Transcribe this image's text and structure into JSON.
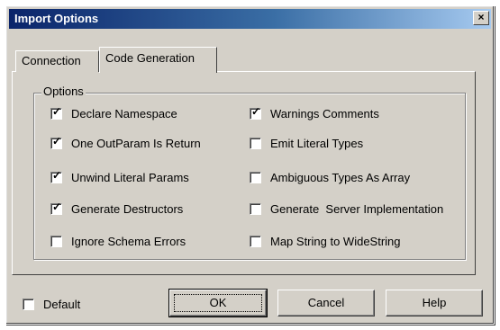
{
  "window": {
    "title": "Import Options",
    "close_glyph": "×"
  },
  "tabs": [
    {
      "label": "Connection",
      "selected": false
    },
    {
      "label": "Code Generation",
      "selected": true
    }
  ],
  "options": {
    "group_label": "Options",
    "left": [
      {
        "label": "Declare Namespace",
        "checked": true
      },
      {
        "label": "One OutParam Is Return",
        "checked": true
      },
      {
        "label": "Unwind Literal Params",
        "checked": true
      },
      {
        "label": "Generate Destructors",
        "checked": true
      },
      {
        "label": "Ignore Schema Errors",
        "checked": false
      }
    ],
    "right": [
      {
        "label": "Warnings Comments",
        "checked": true
      },
      {
        "label": "Emit Literal Types",
        "checked": false
      },
      {
        "label": "Ambiguous Types As Array",
        "checked": false
      },
      {
        "label": "Generate  Server Implementation",
        "checked": false
      },
      {
        "label": "Map String to WideString",
        "checked": false
      }
    ]
  },
  "footer": {
    "default_label": "Default",
    "default_checked": false,
    "ok_label": "OK",
    "cancel_label": "Cancel",
    "help_label": "Help"
  },
  "check_glyph": "✓"
}
